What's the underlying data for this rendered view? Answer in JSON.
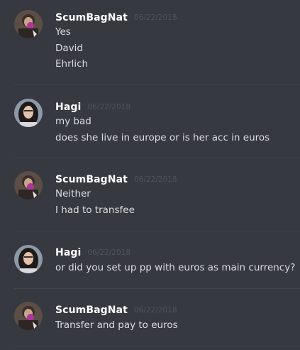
{
  "messages": [
    {
      "author": "ScumBagNat",
      "timestamp": "06/22/2018",
      "lines": [
        "Yes",
        "David",
        "Ehrlich"
      ]
    },
    {
      "author": "Hagi",
      "timestamp": "06/22/2018",
      "lines": [
        "my bad",
        "does she live in europe or is her acc in euros"
      ]
    },
    {
      "author": "ScumBagNat",
      "timestamp": "06/22/2018",
      "lines": [
        "Neither",
        "I had to transfee"
      ]
    },
    {
      "author": "Hagi",
      "timestamp": "06/22/2018",
      "lines": [
        "or did you set up pp with euros as main currency?"
      ]
    },
    {
      "author": "ScumBagNat",
      "timestamp": "06/22/2018",
      "lines": [
        "Transfer and pay to euros"
      ]
    }
  ],
  "colors": {
    "background": "#36393f",
    "username": "#ffffff",
    "timestamp": "#4f545c",
    "message_text": "#dcddde",
    "divider": "#40444b"
  }
}
